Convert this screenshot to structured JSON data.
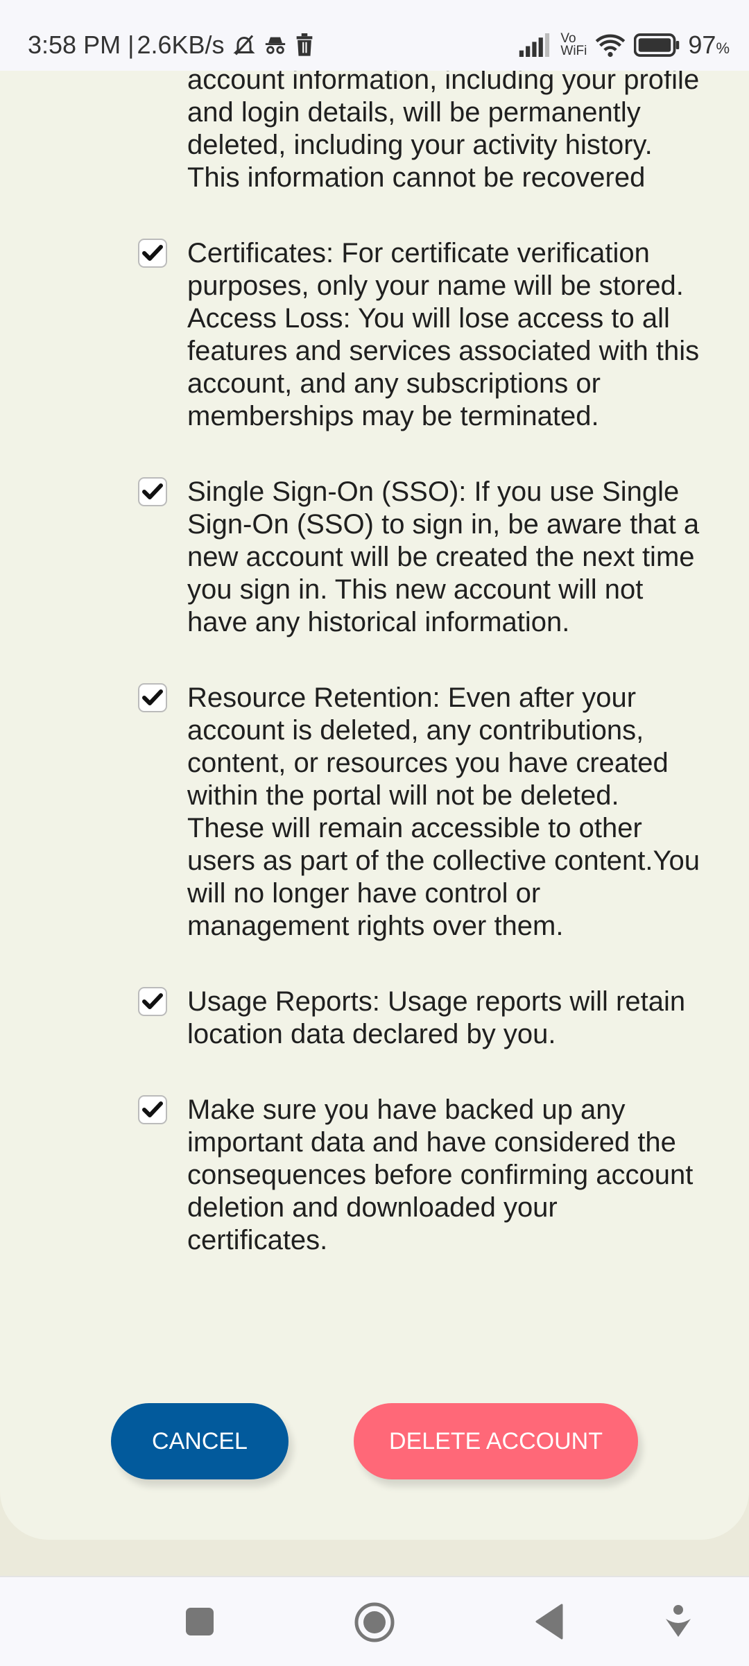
{
  "status_bar": {
    "time": "3:58 PM",
    "separator": "|",
    "speed": "2.6KB/s",
    "icons": [
      "silent-bell-icon",
      "incognito-icon",
      "trash-icon",
      "signal-icon",
      "vowifi-icon",
      "wifi-icon",
      "battery-icon"
    ],
    "vowifi_top": "Vo",
    "vowifi_bottom": "WiFi",
    "battery": "97",
    "battery_unit": "%"
  },
  "consents": [
    {
      "checked": true,
      "text": "Personal Information: Your personal account information, including your profile and login details, will be permanently deleted, including your activity history. This information cannot be recovered"
    },
    {
      "checked": true,
      "text": "Certificates: For certificate verification purposes, only your name will be stored. Access Loss: You will lose access to all features and services associated with this account, and any subscriptions or memberships may be terminated."
    },
    {
      "checked": true,
      "text": "Single Sign-On (SSO): If you use Single Sign-On (SSO) to sign in, be aware that a new account will be created the next time you sign in. This new account will not have any historical information."
    },
    {
      "checked": true,
      "text": "Resource Retention: Even after your account is deleted, any contributions, content, or resources you have created within the portal will not be deleted. These will remain accessible to other users as part of the collective content.You will no longer have control or management rights over them."
    },
    {
      "checked": true,
      "text": "Usage Reports: Usage reports will retain location data declared by you."
    },
    {
      "checked": true,
      "text": "Make sure you have backed up any important data and have considered the consequences before confirming account deletion and downloaded your certificates."
    }
  ],
  "buttons": {
    "cancel": "CANCEL",
    "delete": "DELETE ACCOUNT"
  },
  "colors": {
    "cancel": "#025a9c",
    "delete": "#ff6878",
    "card": "#f2f3e7",
    "page": "#ebeadb"
  },
  "nav_icons": [
    "recents-icon",
    "home-icon",
    "back-icon",
    "assistant-icon"
  ]
}
